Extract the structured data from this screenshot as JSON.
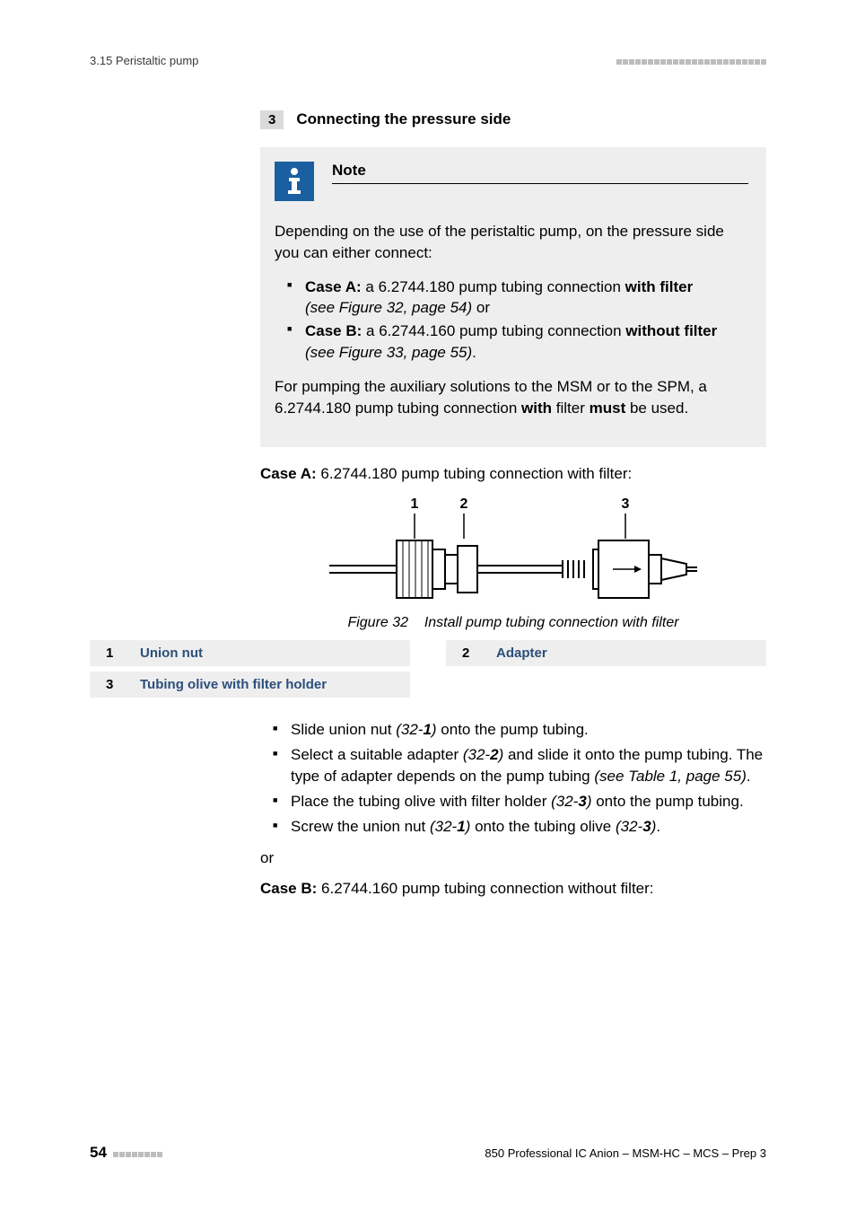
{
  "header": {
    "section": "3.15 Peristaltic pump"
  },
  "step": {
    "num": "3",
    "title": "Connecting the pressure side"
  },
  "note": {
    "label": "Note",
    "intro": "Depending on the use of the peristaltic pump, on the pressure side you can either connect:",
    "caseA_lead": "Case A:",
    "caseA_text": " a 6.2744.180 pump tubing connection ",
    "caseA_bold": "with filter",
    "caseA_ref": "(see Figure 32, page 54)",
    "caseA_tail": " or",
    "caseB_lead": "Case B:",
    "caseB_text": " a 6.2744.160 pump tubing connection ",
    "caseB_bold": "without filter",
    "caseB_ref": "(see Figure 33, page 55)",
    "caseB_tail": ".",
    "outro_1": "For pumping the auxiliary solutions to the MSM or to the SPM, a 6.2744.180 pump tubing connection ",
    "outro_b1": "with",
    "outro_2": " filter ",
    "outro_b2": "must",
    "outro_3": " be used."
  },
  "caseA_heading": {
    "lead": "Case A:",
    "rest": " 6.2744.180 pump tubing connection with filter:"
  },
  "figure": {
    "label1": "1",
    "label2": "2",
    "label3": "3",
    "caption_pre": "Figure 32",
    "caption_text": "Install pump tubing connection with filter"
  },
  "legend": {
    "n1": "1",
    "l1": "Union nut",
    "n2": "2",
    "l2": "Adapter",
    "n3": "3",
    "l3": "Tubing olive with filter holder"
  },
  "instructions": {
    "i1_a": "Slide union nut ",
    "i1_ref": "(32-",
    "i1_num": "1",
    "i1_b": ")",
    "i1_c": " onto the pump tubing.",
    "i2_a": "Select a suitable adapter ",
    "i2_ref": "(32-",
    "i2_num": "2",
    "i2_b": ")",
    "i2_c": " and slide it onto the pump tubing. The type of adapter depends on the pump tubing ",
    "i2_see": "(see Table 1, page 55)",
    "i2_d": ".",
    "i3_a": "Place the tubing olive with filter holder ",
    "i3_ref": "(32-",
    "i3_num": "3",
    "i3_b": ")",
    "i3_c": " onto the pump tubing.",
    "i4_a": "Screw the union nut ",
    "i4_ref1": "(32-",
    "i4_num1": "1",
    "i4_b": ")",
    "i4_c": " onto the tubing olive ",
    "i4_ref2": "(32-",
    "i4_num2": "3",
    "i4_d": ")",
    "i4_e": "."
  },
  "or": "or",
  "caseB_heading": {
    "lead": "Case B:",
    "rest": " 6.2744.160 pump tubing connection without filter:"
  },
  "footer": {
    "page": "54",
    "doc": "850 Professional IC Anion – MSM-HC – MCS – Prep 3"
  }
}
